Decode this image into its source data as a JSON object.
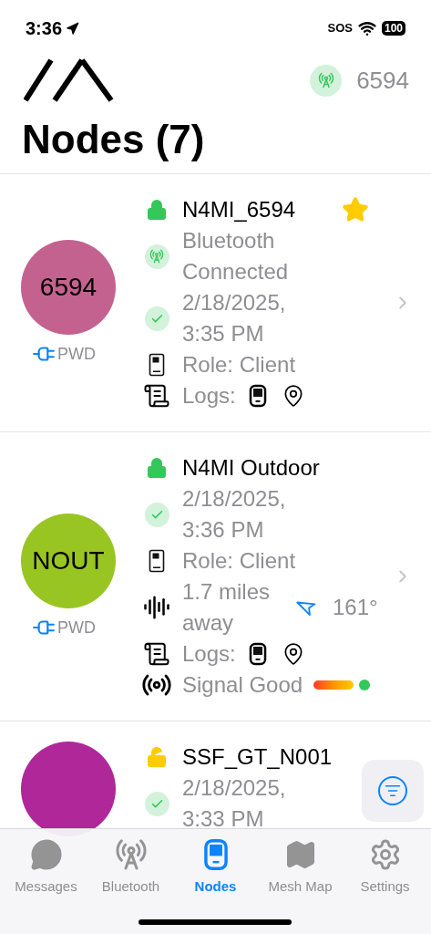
{
  "status_bar": {
    "time": "3:36",
    "carrier": "SOS",
    "battery": "100"
  },
  "header": {
    "connected_node": "6594",
    "title": "Nodes (7)"
  },
  "nodes": [
    {
      "short_name": "6594",
      "color": "#c4628f",
      "power": "PWD",
      "name": "N4MI_6594",
      "locked": true,
      "favorite": true,
      "rows": [
        {
          "kind": "bluetooth",
          "text": "Bluetooth Connected"
        },
        {
          "kind": "last_heard",
          "text": "2/18/2025, 3:35 PM"
        },
        {
          "kind": "role",
          "text": "Role: Client"
        },
        {
          "kind": "logs",
          "text": "Logs:"
        }
      ]
    },
    {
      "short_name": "NOUT",
      "color": "#99c523",
      "power": "PWD",
      "name": "N4MI Outdoor",
      "locked": true,
      "favorite": false,
      "rows": [
        {
          "kind": "last_heard",
          "text": "2/18/2025, 3:36 PM"
        },
        {
          "kind": "role",
          "text": "Role: Client"
        },
        {
          "kind": "distance",
          "text": "1.7 miles away",
          "heading": "161°"
        },
        {
          "kind": "logs",
          "text": "Logs:"
        },
        {
          "kind": "signal",
          "text": "Signal Good"
        }
      ]
    },
    {
      "color": "#b0279a",
      "name": "SSF_GT_N001",
      "locked": false,
      "favorite": false,
      "rows": [
        {
          "kind": "last_heard",
          "text": "2/18/2025, 3:33 PM"
        }
      ]
    }
  ],
  "tabs": [
    {
      "label": "Messages",
      "selected": false
    },
    {
      "label": "Bluetooth",
      "selected": false
    },
    {
      "label": "Nodes",
      "selected": true
    },
    {
      "label": "Mesh Map",
      "selected": false
    },
    {
      "label": "Settings",
      "selected": false
    }
  ]
}
